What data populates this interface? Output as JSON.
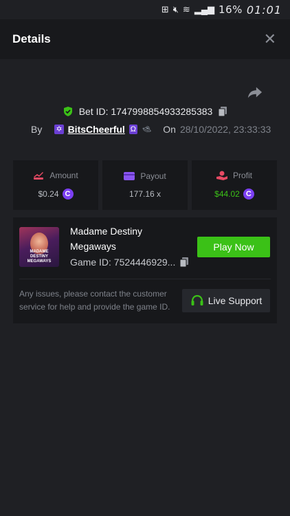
{
  "status_bar": {
    "battery": "16%",
    "time": "01:01"
  },
  "header": {
    "title": "Details",
    "close_symbol": "✕"
  },
  "bet": {
    "id_label": "Bet ID:",
    "id_value": "1747998854933285383",
    "by_label": "By",
    "username": "BitsCheerful",
    "on_label": "On",
    "datetime": "28/10/2022, 23:33:33"
  },
  "stats": {
    "amount": {
      "label": "Amount",
      "value": "$0.24"
    },
    "payout": {
      "label": "Payout",
      "value": "177.16 x"
    },
    "profit": {
      "label": "Profit",
      "value": "$44.02"
    }
  },
  "game": {
    "name": "Madame Destiny Megaways",
    "thumb_text": "MADAME DESTINY MEGAWAYS",
    "id_label": "Game ID:",
    "id_value": "7524446929...",
    "play_label": "Play Now",
    "help_text": "Any issues, please contact the customer service for help and provide the game ID.",
    "support_label": "Live Support"
  },
  "colors": {
    "accent_green": "#3bc117",
    "coin_purple": "#7b3ff2",
    "profit_green": "#3bc117"
  }
}
